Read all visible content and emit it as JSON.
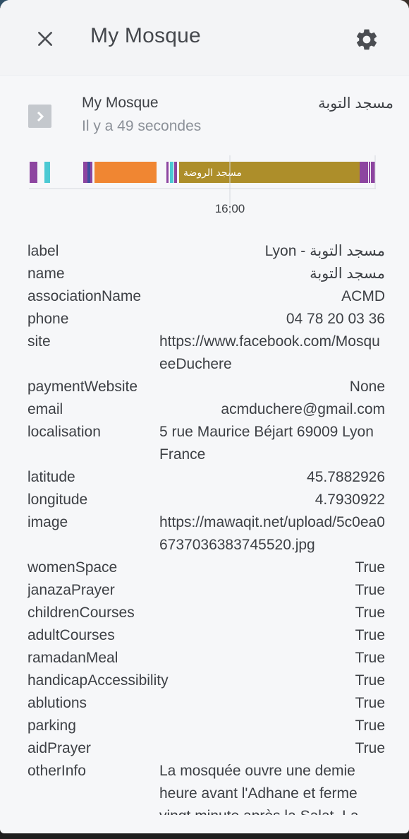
{
  "header": {
    "title": "My Mosque",
    "close_icon": "close-icon",
    "settings_icon": "gear-icon"
  },
  "entity": {
    "name": "My Mosque",
    "last_changed": "Il y a 49 secondes",
    "state": "مسجد التوبة",
    "expand_icon": "chevron-right-icon"
  },
  "timeline": {
    "tick_label": "16:00",
    "segment_label": "مسجد الروضة",
    "colors": {
      "purple": "#8d45a0",
      "cyan": "#4bc9d3",
      "orange": "#f08632",
      "olive": "#ad8e2a",
      "navy": "#3f4fa0"
    }
  },
  "attributes": [
    {
      "key": "label",
      "value": "Lyon - مسجد التوبة"
    },
    {
      "key": "name",
      "value": "مسجد التوبة"
    },
    {
      "key": "associationName",
      "value": "ACMD"
    },
    {
      "key": "phone",
      "value": "04 78 20 03 36"
    },
    {
      "key": "site",
      "value": "https://www.facebook.com/MosqueeDuchere"
    },
    {
      "key": "paymentWebsite",
      "value": "None"
    },
    {
      "key": "email",
      "value": "acmduchere@gmail.com"
    },
    {
      "key": "localisation",
      "value": "5 rue Maurice Béjart 69009 Lyon France"
    },
    {
      "key": "latitude",
      "value": "45.7882926"
    },
    {
      "key": "longitude",
      "value": "4.7930922"
    },
    {
      "key": "image",
      "value": "https://mawaqit.net/upload/5c0ea06737036383745520.jpg"
    },
    {
      "key": "womenSpace",
      "value": "True"
    },
    {
      "key": "janazaPrayer",
      "value": "True"
    },
    {
      "key": "childrenCourses",
      "value": "True"
    },
    {
      "key": "adultCourses",
      "value": "True"
    },
    {
      "key": "ramadanMeal",
      "value": "True"
    },
    {
      "key": "handicapAccessibility",
      "value": "True"
    },
    {
      "key": "ablutions",
      "value": "True"
    },
    {
      "key": "parking",
      "value": "True"
    },
    {
      "key": "aidPrayer",
      "value": "True"
    },
    {
      "key": "otherInfo",
      "value": "La mosquée ouvre une demie heure avant l'Adhane et ferme vingt minute après la Salat. La"
    }
  ]
}
